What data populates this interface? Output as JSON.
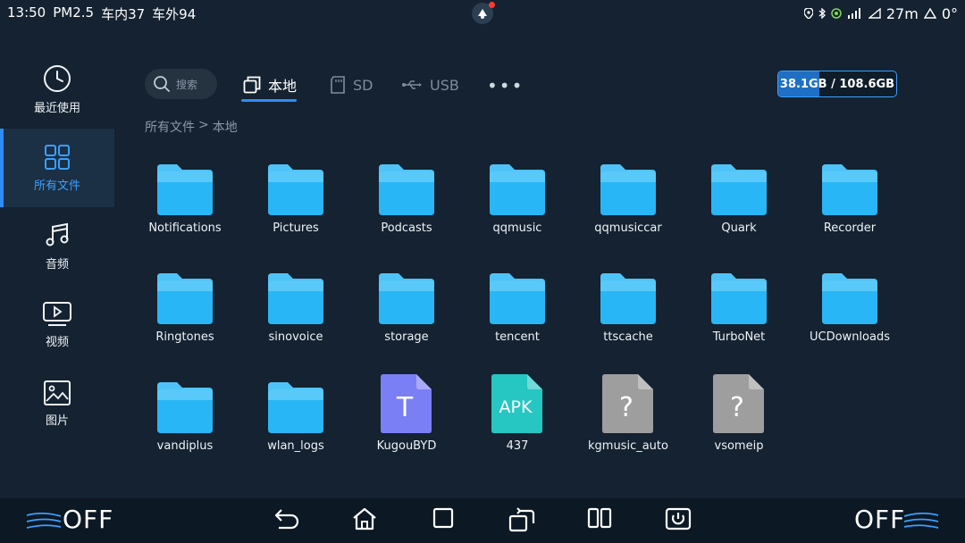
{
  "status": {
    "time": "13:50",
    "pm25": "PM2.5",
    "inside": "车内37",
    "outside": "车外94",
    "distance": "27m",
    "temp": "0°"
  },
  "sidebar": {
    "items": [
      {
        "label": "最近使用",
        "icon": "clock-icon"
      },
      {
        "label": "所有文件",
        "icon": "grid-icon",
        "active": true
      },
      {
        "label": "音频",
        "icon": "music-icon"
      },
      {
        "label": "视频",
        "icon": "video-icon"
      },
      {
        "label": "图片",
        "icon": "image-icon"
      }
    ]
  },
  "toolbar": {
    "search_placeholder": "搜索",
    "tabs": [
      "本地",
      "SD",
      "USB"
    ],
    "active_tab": "本地",
    "storage_used": "38.1GB",
    "storage_total": "108.6GB",
    "storage_text": "38.1GB / 108.6GB",
    "storage_fraction": 0.35
  },
  "breadcrumb": {
    "root": "所有文件",
    "separator": ">",
    "current": "本地"
  },
  "files": [
    {
      "name": "Notifications",
      "type": "folder"
    },
    {
      "name": "Pictures",
      "type": "folder"
    },
    {
      "name": "Podcasts",
      "type": "folder"
    },
    {
      "name": "qqmusic",
      "type": "folder"
    },
    {
      "name": "qqmusiccar",
      "type": "folder"
    },
    {
      "name": "Quark",
      "type": "folder"
    },
    {
      "name": "Recorder",
      "type": "folder"
    },
    {
      "name": "Ringtones",
      "type": "folder"
    },
    {
      "name": "sinovoice",
      "type": "folder"
    },
    {
      "name": "storage",
      "type": "folder"
    },
    {
      "name": "tencent",
      "type": "folder"
    },
    {
      "name": "ttscache",
      "type": "folder"
    },
    {
      "name": "TurboNet",
      "type": "folder"
    },
    {
      "name": "UCDownloads",
      "type": "folder"
    },
    {
      "name": "vandiplus",
      "type": "folder"
    },
    {
      "name": "wlan_logs",
      "type": "folder"
    },
    {
      "name": "KugouBYD",
      "type": "text",
      "glyph": "T"
    },
    {
      "name": "437",
      "type": "apk",
      "glyph": "APK"
    },
    {
      "name": "kgmusic_auto",
      "type": "unknown",
      "glyph": "?"
    },
    {
      "name": "vsomeip",
      "type": "unknown",
      "glyph": "?"
    }
  ],
  "bottom": {
    "left_ac": "OFF",
    "right_ac": "OFF",
    "nav": [
      "back-icon",
      "home-icon",
      "square-icon",
      "rotate-icon",
      "split-icon",
      "power-icon"
    ]
  },
  "colors": {
    "accent": "#2e8df5",
    "folder": "#29b6f6",
    "text_file": "#7b7ff5",
    "apk_file": "#26c6c2",
    "unknown_file": "#9e9e9e"
  }
}
